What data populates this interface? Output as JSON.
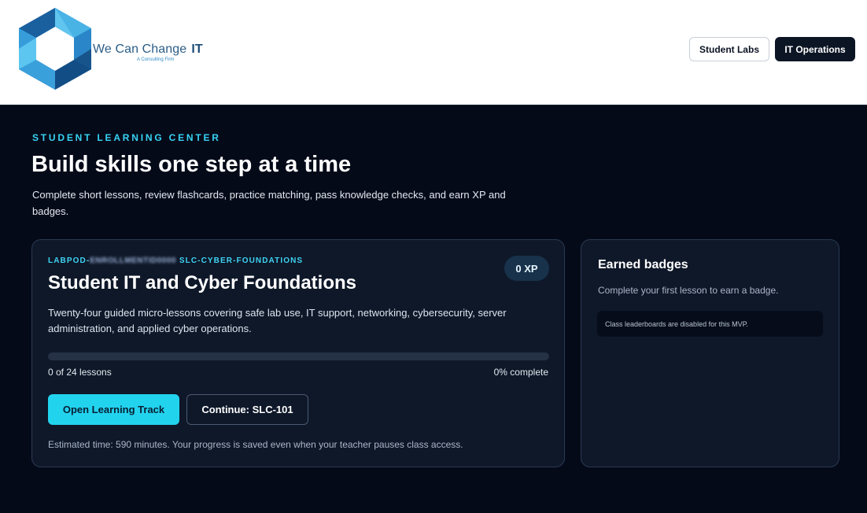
{
  "header": {
    "brand_name": "We Can Change",
    "brand_it": "IT",
    "brand_subtitle": "A Consulting Firm",
    "nav": {
      "student_labs": "Student Labs",
      "it_operations": "IT Operations"
    }
  },
  "hero": {
    "eyebrow": "STUDENT LEARNING CENTER",
    "title": "Build skills one step at a time",
    "description": "Complete short lessons, review flashcards, practice matching, pass knowledge checks, and earn XP and badges."
  },
  "track": {
    "code_prefix": "LABPOD-",
    "code_redacted": "ENROLLMENTID0000",
    "code_suffix": "SLC-CYBER-FOUNDATIONS",
    "xp": "0 XP",
    "title": "Student IT and Cyber Foundations",
    "description": "Twenty-four guided micro-lessons covering safe lab use, IT support, networking, cybersecurity, server administration, and applied cyber operations.",
    "progress_fraction": 0,
    "lessons_done": "0 of 24 lessons",
    "percent_complete": "0% complete",
    "open_button": "Open Learning Track",
    "continue_button": "Continue: SLC-101",
    "note": "Estimated time: 590 minutes. Your progress is saved even when your teacher pauses class access."
  },
  "badges": {
    "title": "Earned badges",
    "description": "Complete your first lesson to earn a badge.",
    "note": "Class leaderboards are disabled for this MVP."
  },
  "colors": {
    "accent": "#22d3ee",
    "background": "#050a19",
    "card": "#0e1829",
    "logo_blue": "#1f6fb5"
  },
  "icons": {
    "logo": "hexagon-logo"
  }
}
